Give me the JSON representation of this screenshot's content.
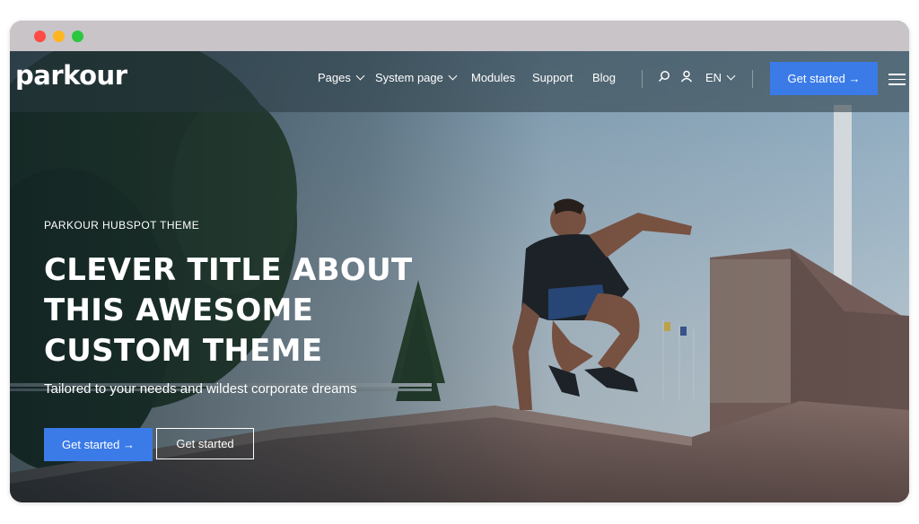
{
  "nav": {
    "logo": "parkour",
    "items": [
      {
        "label": "Pages",
        "dropdown": true
      },
      {
        "label": "System page",
        "dropdown": true
      },
      {
        "label": "Modules",
        "dropdown": false
      },
      {
        "label": "Support",
        "dropdown": false
      },
      {
        "label": "Blog",
        "dropdown": false
      }
    ],
    "language": "EN",
    "cta_label": "Get started →"
  },
  "hero": {
    "eyebrow": "PARKOUR HUBSPOT THEME",
    "headline_lines": [
      "CLEVER TITLE ABOUT",
      "THIS AWESOME",
      "CUSTOM THEME"
    ],
    "subtitle": "Tailored to your needs and wildest corporate dreams",
    "primary_button": "Get started →",
    "secondary_button": "Get started"
  },
  "colors": {
    "accent": "#3a7be8",
    "text": "#ffffff",
    "window_dot_red": "#ff4b45",
    "window_dot_yellow": "#ffb520",
    "window_dot_green": "#29c840"
  },
  "icons": [
    "search-icon",
    "user-icon",
    "chevron-down-icon",
    "menu-icon"
  ]
}
